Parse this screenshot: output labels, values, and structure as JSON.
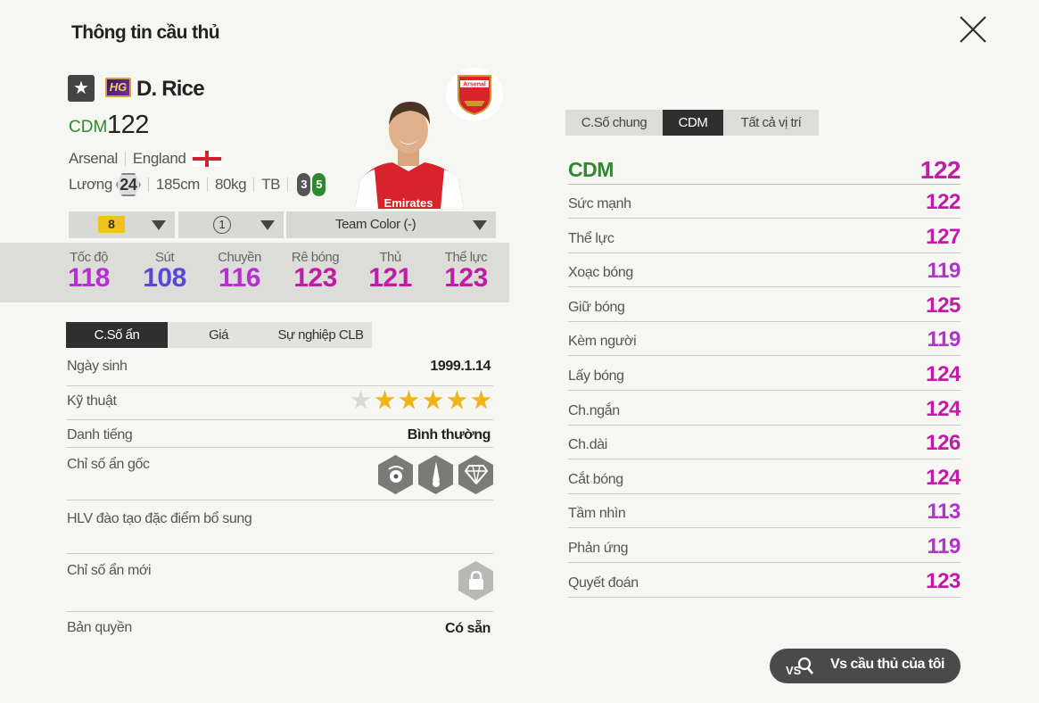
{
  "header": {
    "title": "Thông tin cầu thủ"
  },
  "player": {
    "badge": "★",
    "hg": "HG",
    "name": "D. Rice",
    "position": "CDM",
    "overall": "122",
    "club": "Arsenal",
    "nation": "England",
    "salary_label": "Lương",
    "salary": "24",
    "height": "185cm",
    "weight": "80kg",
    "body": "TB",
    "left_foot": "3",
    "right_foot": "5",
    "club_logo_text": "Arsenal"
  },
  "selectors": {
    "level": "8",
    "upgrade": "1",
    "team_color": "Team Color (-)"
  },
  "stats": [
    {
      "label": "Tốc độ",
      "value": "118",
      "color": "#b72fd0"
    },
    {
      "label": "Sút",
      "value": "108",
      "color": "#5a47d9"
    },
    {
      "label": "Chuyền",
      "value": "116",
      "color": "#b72fd0"
    },
    {
      "label": "Rê bóng",
      "value": "123",
      "color": "#c21ba8"
    },
    {
      "label": "Thủ",
      "value": "121",
      "color": "#c21ba8"
    },
    {
      "label": "Thể lực",
      "value": "123",
      "color": "#c21ba8"
    }
  ],
  "left_tabs": [
    "C.Số ẩn",
    "Giá",
    "Sự nghiệp CLB"
  ],
  "info": {
    "birth_label": "Ngày sinh",
    "birth": "1999.1.14",
    "skill_label": "Kỹ thuật",
    "skill_stars": 5,
    "skill_max": 6,
    "fame_label": "Danh tiếng",
    "fame": "Bình thường",
    "traits_label": "Chỉ số ẩn gốc",
    "coach_label": "HLV đào tạo đặc điểm bổ sung",
    "new_traits_label": "Chỉ số ẩn mới",
    "license_label": "Bản quyền",
    "license": "Có sẵn"
  },
  "right_tabs": [
    "C.Số chung",
    "CDM",
    "Tất cả vị trí"
  ],
  "position_rating": {
    "label": "CDM",
    "value": "122"
  },
  "attributes": [
    {
      "label": "Sức mạnh",
      "value": "122",
      "color": "#c21ba8"
    },
    {
      "label": "Thể lực",
      "value": "127",
      "color": "#c21ba8"
    },
    {
      "label": "Xoạc bóng",
      "value": "119",
      "color": "#b72fd0"
    },
    {
      "label": "Giữ bóng",
      "value": "125",
      "color": "#c21ba8"
    },
    {
      "label": "Kèm người",
      "value": "119",
      "color": "#b72fd0"
    },
    {
      "label": "Lấy bóng",
      "value": "124",
      "color": "#c21ba8"
    },
    {
      "label": "Ch.ngắn",
      "value": "124",
      "color": "#c21ba8"
    },
    {
      "label": "Ch.dài",
      "value": "126",
      "color": "#c21ba8"
    },
    {
      "label": "Cắt bóng",
      "value": "124",
      "color": "#c21ba8"
    },
    {
      "label": "Tầm nhìn",
      "value": "113",
      "color": "#b72fd0"
    },
    {
      "label": "Phản ứng",
      "value": "119",
      "color": "#b72fd0"
    },
    {
      "label": "Quyết đoán",
      "value": "123",
      "color": "#c21ba8"
    }
  ],
  "vs_button": {
    "icon_text": "VS",
    "label": "Vs cầu thủ của tôi"
  }
}
